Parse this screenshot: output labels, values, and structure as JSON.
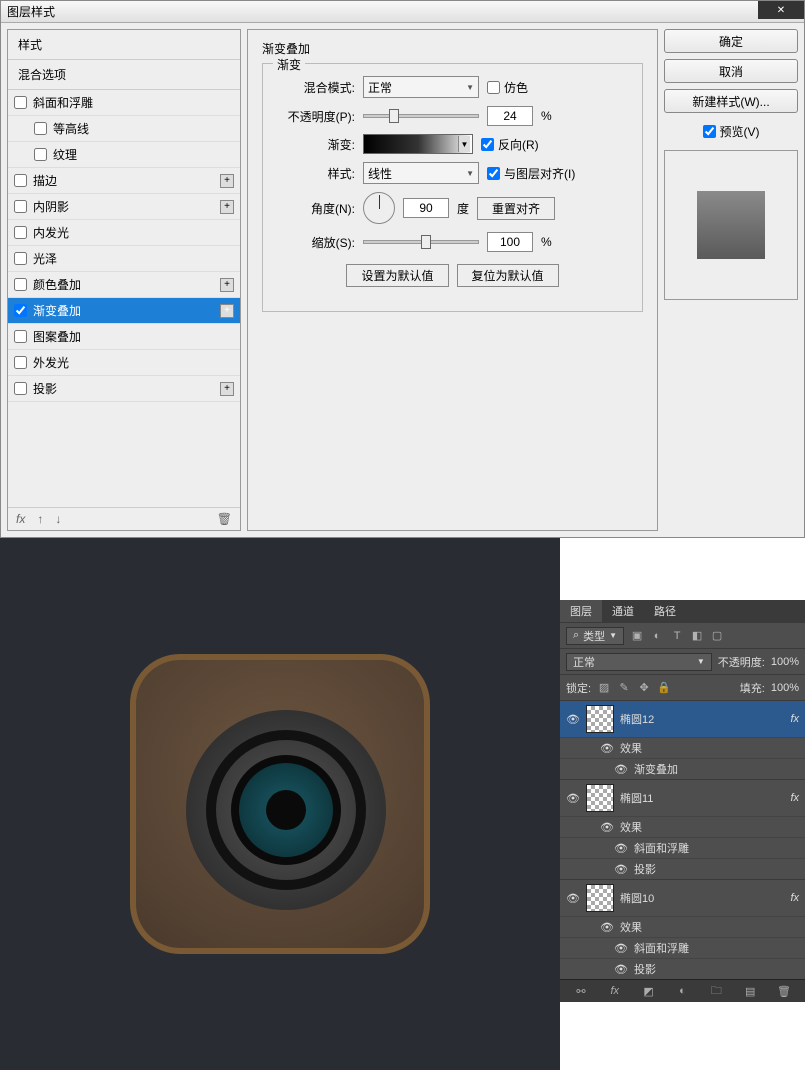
{
  "dialog": {
    "title": "图层样式",
    "styles_header": "样式",
    "blend_options": "混合选项",
    "items": [
      {
        "label": "斜面和浮雕",
        "checked": false,
        "indent": false,
        "plus": false
      },
      {
        "label": "等高线",
        "checked": false,
        "indent": true,
        "plus": false
      },
      {
        "label": "纹理",
        "checked": false,
        "indent": true,
        "plus": false
      },
      {
        "label": "描边",
        "checked": false,
        "indent": false,
        "plus": true
      },
      {
        "label": "内阴影",
        "checked": false,
        "indent": false,
        "plus": true
      },
      {
        "label": "内发光",
        "checked": false,
        "indent": false,
        "plus": false
      },
      {
        "label": "光泽",
        "checked": false,
        "indent": false,
        "plus": false
      },
      {
        "label": "颜色叠加",
        "checked": false,
        "indent": false,
        "plus": true
      },
      {
        "label": "渐变叠加",
        "checked": true,
        "indent": false,
        "plus": true,
        "selected": true
      },
      {
        "label": "图案叠加",
        "checked": false,
        "indent": false,
        "plus": false
      },
      {
        "label": "外发光",
        "checked": false,
        "indent": false,
        "plus": false
      },
      {
        "label": "投影",
        "checked": false,
        "indent": false,
        "plus": true
      }
    ],
    "footer_fx": "fx"
  },
  "settings": {
    "section_title": "渐变叠加",
    "fieldset_label": "渐变",
    "blend_mode_label": "混合模式:",
    "blend_mode_value": "正常",
    "dither_label": "仿色",
    "opacity_label": "不透明度(P):",
    "opacity_value": "24",
    "opacity_unit": "%",
    "gradient_label": "渐变:",
    "reverse_label": "反向(R)",
    "style_label": "样式:",
    "style_value": "线性",
    "align_label": "与图层对齐(I)",
    "angle_label": "角度(N):",
    "angle_value": "90",
    "angle_unit": "度",
    "reset_align": "重置对齐",
    "scale_label": "缩放(S):",
    "scale_value": "100",
    "scale_unit": "%",
    "set_default": "设置为默认值",
    "reset_default": "复位为默认值"
  },
  "rightcol": {
    "ok": "确定",
    "cancel": "取消",
    "new_style": "新建样式(W)...",
    "preview": "预览(V)"
  },
  "layers_panel": {
    "tabs": [
      "图层",
      "通道",
      "路径"
    ],
    "kind_label": "类型",
    "blend_mode": "正常",
    "opacity_label": "不透明度:",
    "opacity_value": "100%",
    "lock_label": "锁定:",
    "fill_label": "填充:",
    "fill_value": "100%",
    "layers": [
      {
        "name": "椭圆12",
        "selected": true,
        "fx": "fx",
        "effects_label": "效果",
        "effects": [
          "渐变叠加"
        ]
      },
      {
        "name": "椭圆11",
        "selected": false,
        "fx": "fx",
        "effects_label": "效果",
        "effects": [
          "斜面和浮雕",
          "投影"
        ]
      },
      {
        "name": "椭圆10",
        "selected": false,
        "fx": "fx",
        "effects_label": "效果",
        "effects": [
          "斜面和浮雕",
          "投影"
        ]
      }
    ]
  }
}
